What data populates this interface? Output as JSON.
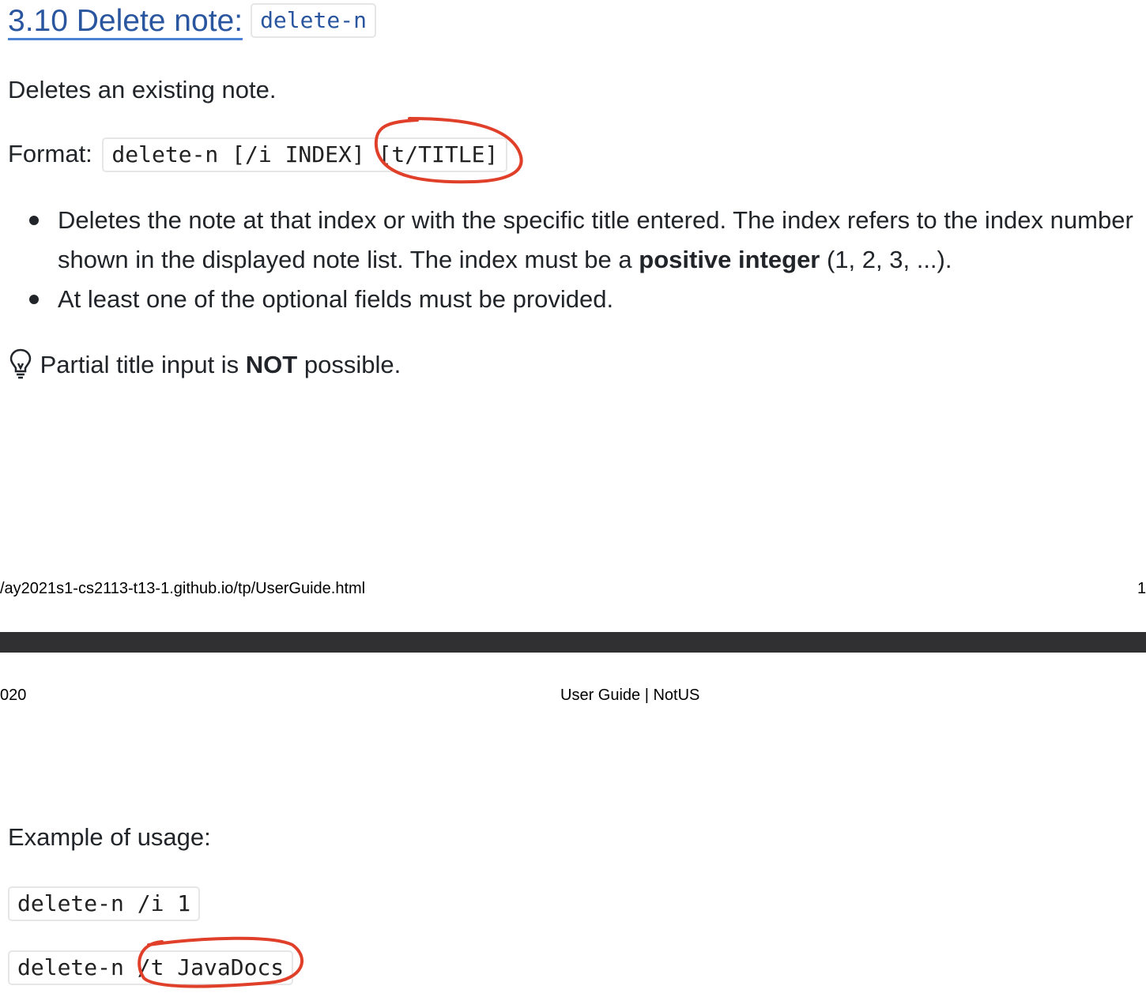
{
  "section": {
    "heading": "3.10 Delete note:",
    "heading_code": "delete-n",
    "description": "Deletes an existing note.",
    "format_label": "Format:",
    "format_code": "delete-n [/i INDEX] [t/TITLE]",
    "bullets": [
      {
        "before": "Deletes the note at that index or with the specific title entered. The index refers to the index number shown in the displayed note list. The index must be a ",
        "bold": "positive integer",
        "after": " (1, 2, 3, ...)."
      },
      {
        "before": "At least one of the optional fields must be provided.",
        "bold": "",
        "after": ""
      }
    ],
    "tip": {
      "icon": "lightbulb-icon",
      "before": "Partial title input is ",
      "bold": "NOT",
      "after": " possible."
    },
    "example_label": "Example of usage:",
    "examples": [
      "delete-n /i 1",
      "delete-n /t JavaDocs"
    ]
  },
  "page_footer": {
    "url": "/ay2021s1-cs2113-t13-1.github.io/tp/UserGuide.html",
    "page_number": "1"
  },
  "page_header": {
    "date_fragment": "020",
    "title": "User Guide | NotUS"
  },
  "colors": {
    "link": "#2a56a0",
    "annotation": "#e0402a",
    "page_separator": "#303033"
  }
}
